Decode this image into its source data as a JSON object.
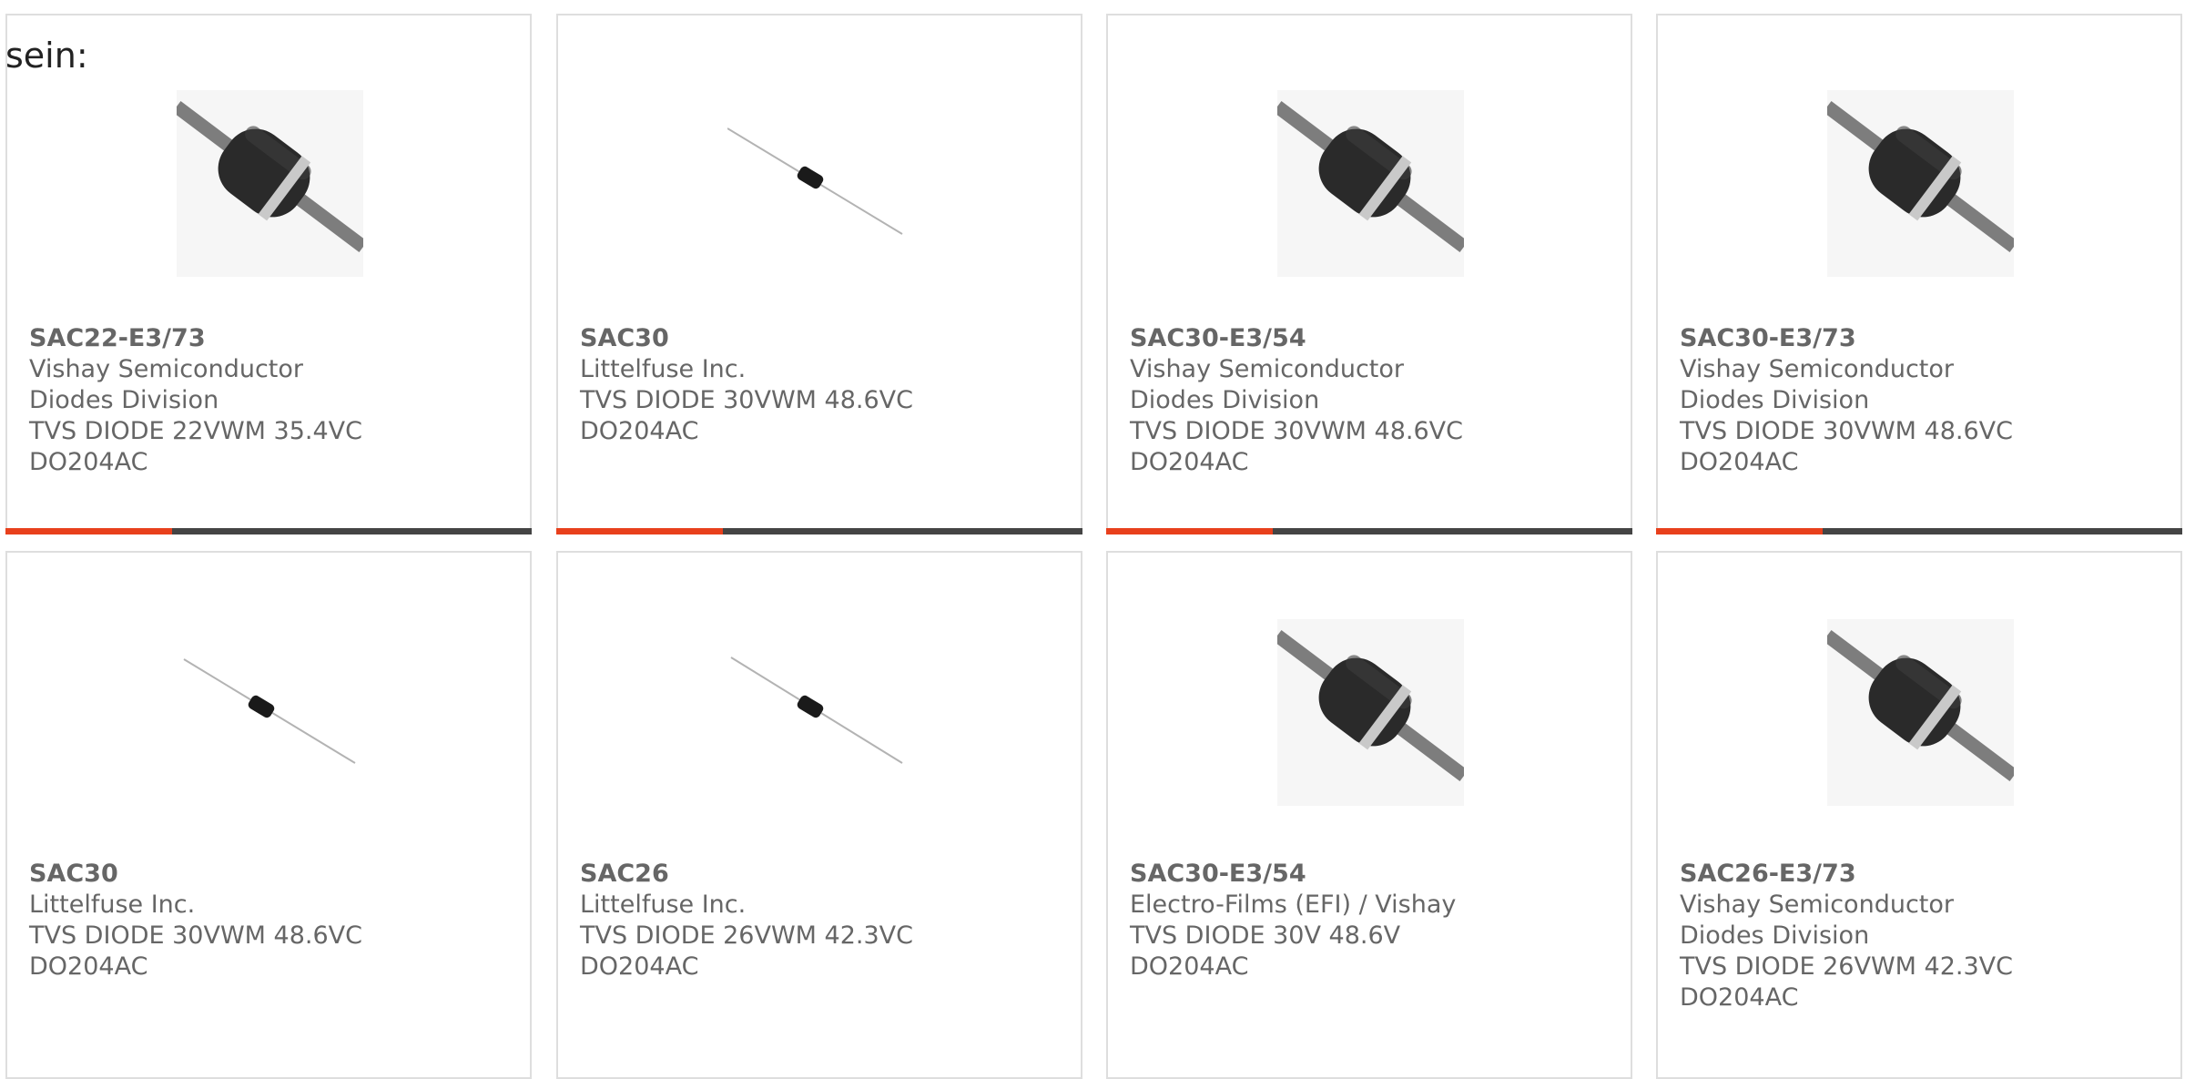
{
  "intro_text": "sein:",
  "accent_color": "#e8401c",
  "bar_color": "#444444",
  "products": [
    {
      "part_number": "SAC22-E3/73",
      "manufacturer": "Vishay Semiconductor Diodes Division",
      "description": "TVS DIODE 22VWM 35.4VC DO204AC",
      "image": "diode-large-icon"
    },
    {
      "part_number": "SAC30",
      "manufacturer": "Littelfuse Inc.",
      "description": "TVS DIODE 30VWM 48.6VC DO204AC",
      "image": "diode-small-icon"
    },
    {
      "part_number": "SAC30-E3/54",
      "manufacturer": "Vishay Semiconductor Diodes Division",
      "description": "TVS DIODE 30VWM 48.6VC DO204AC",
      "image": "diode-large-icon"
    },
    {
      "part_number": "SAC30-E3/73",
      "manufacturer": "Vishay Semiconductor Diodes Division",
      "description": "TVS DIODE 30VWM 48.6VC DO204AC",
      "image": "diode-large-icon"
    },
    {
      "part_number": "SAC30",
      "manufacturer": "Littelfuse Inc.",
      "description": "TVS DIODE 30VWM 48.6VC DO204AC",
      "image": "diode-small-icon"
    },
    {
      "part_number": "SAC26",
      "manufacturer": "Littelfuse Inc.",
      "description": "TVS DIODE 26VWM 42.3VC DO204AC",
      "image": "diode-small-icon"
    },
    {
      "part_number": "SAC30-E3/54",
      "manufacturer": "Electro-Films (EFI) / Vishay",
      "description": "TVS DIODE 30V 48.6V DO204AC",
      "image": "diode-large-icon"
    },
    {
      "part_number": "SAC26-E3/73",
      "manufacturer": "Vishay Semiconductor Diodes Division",
      "description": "TVS DIODE 26VWM 42.3VC DO204AC",
      "image": "diode-large-icon"
    }
  ]
}
